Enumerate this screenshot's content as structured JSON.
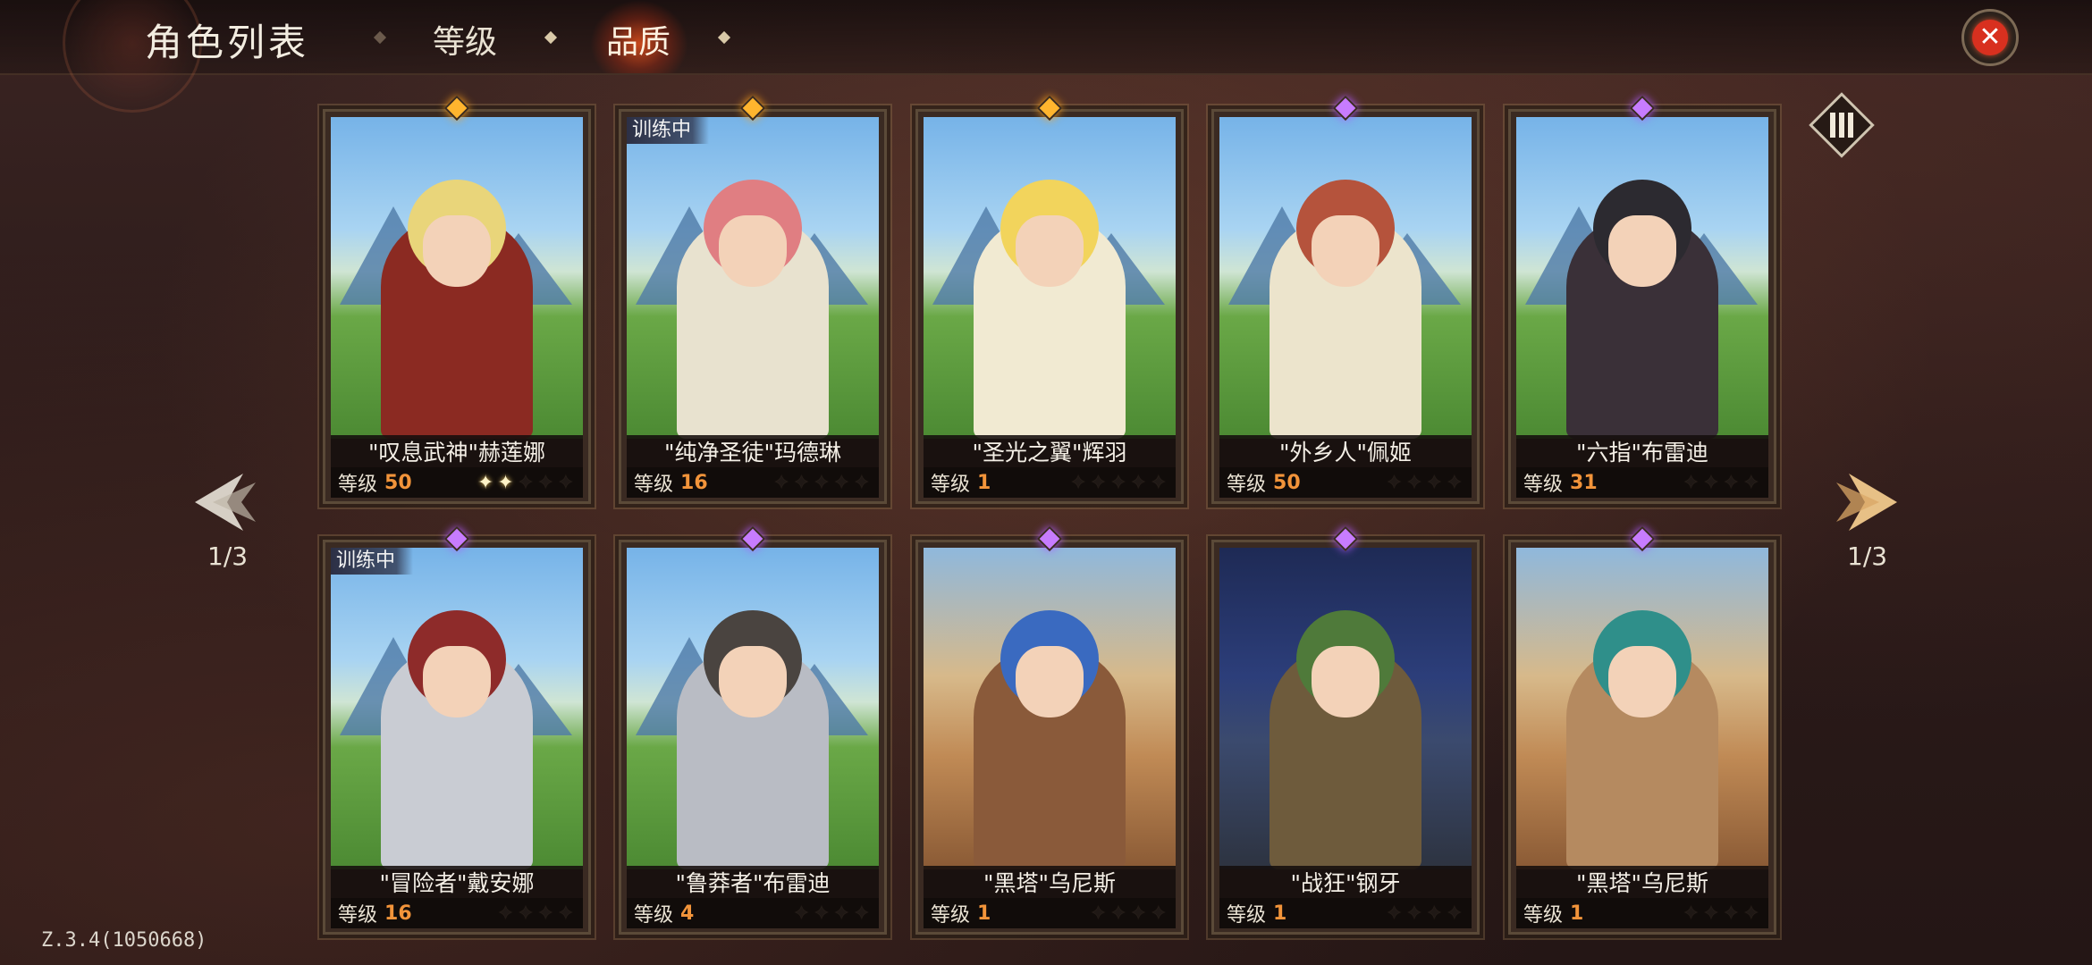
{
  "header": {
    "title": "角色列表",
    "tabs": [
      {
        "label": "等级",
        "active": false
      },
      {
        "label": "品质",
        "active": true
      }
    ]
  },
  "pager": {
    "left": "1/3",
    "right": "1/3"
  },
  "level_label": "等级",
  "training_label": "训练中",
  "version": "Z.3.4(1050668)",
  "colors": {
    "level_value": "#f2943a",
    "gem_orange": "#ffb52e",
    "gem_purple": "#c77cff",
    "close_red": "#d8301f"
  },
  "cards": [
    {
      "name": "\"叹息武神\"赫莲娜",
      "level": "50",
      "stars_lit": 2,
      "stars_total": 5,
      "gem": "orange",
      "training": false
    },
    {
      "name": "\"纯净圣徒\"玛德琳",
      "level": "16",
      "stars_lit": 0,
      "stars_total": 5,
      "gem": "orange",
      "training": true
    },
    {
      "name": "\"圣光之翼\"辉羽",
      "level": "1",
      "stars_lit": 0,
      "stars_total": 5,
      "gem": "orange",
      "training": false
    },
    {
      "name": "\"外乡人\"佩姬",
      "level": "50",
      "stars_lit": 0,
      "stars_total": 4,
      "gem": "purple",
      "training": false
    },
    {
      "name": "\"六指\"布雷迪",
      "level": "31",
      "stars_lit": 0,
      "stars_total": 4,
      "gem": "purple",
      "training": false
    },
    {
      "name": "\"冒险者\"戴安娜",
      "level": "16",
      "stars_lit": 0,
      "stars_total": 4,
      "gem": "purple",
      "training": true
    },
    {
      "name": "\"鲁莽者\"布雷迪",
      "level": "4",
      "stars_lit": 0,
      "stars_total": 4,
      "gem": "purple",
      "training": false
    },
    {
      "name": "\"黑塔\"乌尼斯",
      "level": "1",
      "stars_lit": 0,
      "stars_total": 4,
      "gem": "purple",
      "training": false
    },
    {
      "name": "\"战狂\"钢牙",
      "level": "1",
      "stars_lit": 0,
      "stars_total": 4,
      "gem": "purple",
      "training": false
    },
    {
      "name": "\"黑塔\"乌尼斯",
      "level": "1",
      "stars_lit": 0,
      "stars_total": 4,
      "gem": "purple",
      "training": false
    }
  ]
}
